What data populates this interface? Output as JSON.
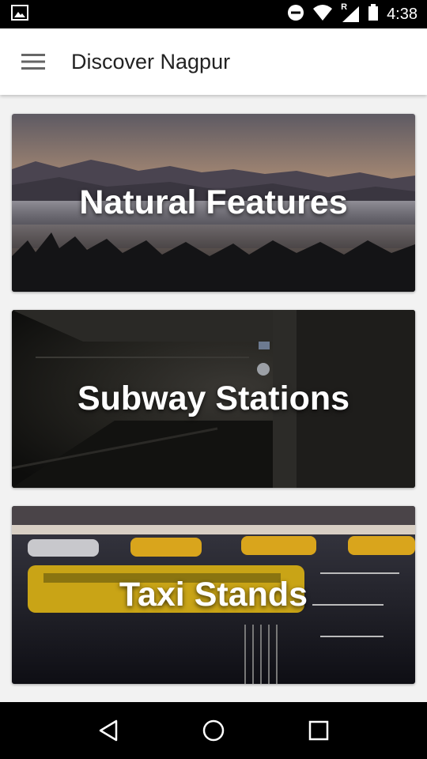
{
  "status_bar": {
    "time": "4:38",
    "network_badge": "R",
    "icons": [
      "image-notification-icon",
      "do-not-disturb-icon",
      "wifi-icon",
      "cell-signal-icon",
      "battery-icon"
    ]
  },
  "app_bar": {
    "menu_icon": "hamburger-menu-icon",
    "title": "Discover Nagpur"
  },
  "categories": [
    {
      "label": "Natural Features"
    },
    {
      "label": "Subway Stations"
    },
    {
      "label": "Taxi Stands"
    }
  ],
  "nav_bar": {
    "icons": [
      "back-icon",
      "home-icon",
      "recents-icon"
    ]
  }
}
